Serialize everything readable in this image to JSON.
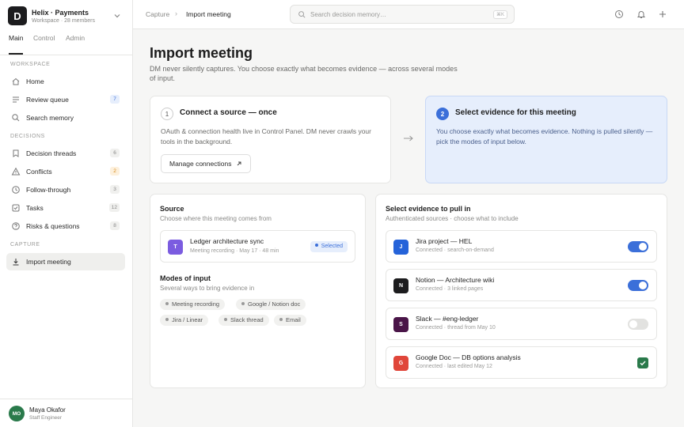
{
  "workspace": {
    "logo": "D",
    "name": "Helix · Payments",
    "subtitle": "Workspace · 28 members"
  },
  "top_tabs": [
    "Main",
    "Control",
    "Admin"
  ],
  "sidebar": {
    "workspace_heading": "WORKSPACE",
    "workspace_items": [
      {
        "label": "Home",
        "icon": "home-icon"
      },
      {
        "label": "Review queue",
        "count": "7",
        "icon": "list-icon"
      },
      {
        "label": "Search memory",
        "icon": "search-icon"
      }
    ],
    "decisions_heading": "DECISIONS",
    "decisions_items": [
      {
        "label": "Decision threads",
        "count": "6",
        "icon": "bookmark-icon"
      },
      {
        "label": "Conflicts",
        "count": "2",
        "icon": "warning-icon"
      },
      {
        "label": "Follow-through",
        "count": "3",
        "icon": "clock-icon"
      },
      {
        "label": "Tasks",
        "count": "12",
        "icon": "checkbox-icon"
      },
      {
        "label": "Risks & questions",
        "count": "8",
        "icon": "question-icon"
      }
    ],
    "capture_heading": "CAPTURE",
    "capture_items": [
      {
        "label": "Import meeting",
        "icon": "download-icon",
        "active": true
      }
    ]
  },
  "user": {
    "initials": "MO",
    "name": "Maya Okafor",
    "role": "Staff Engineer"
  },
  "breadcrumb": {
    "parent": "Capture",
    "separator": "›",
    "current": "Import meeting"
  },
  "search": {
    "placeholder": "Search decision memory…",
    "shortcut": "⌘K"
  },
  "page": {
    "title": "Import meeting",
    "lede": "DM never silently captures. You choose exactly what becomes evidence — across several modes of input."
  },
  "steps": [
    {
      "number": "1",
      "title": "Connect a source — once",
      "body": "OAuth & connection health live in Control Panel. DM never crawls your tools in the background.",
      "button": "Manage connections"
    },
    {
      "number": "2",
      "title": "Select evidence for this meeting",
      "body": "You choose exactly what becomes evidence. Nothing is pulled silently — pick the modes of input below."
    }
  ],
  "source": {
    "title": "Source",
    "subtitle": "Choose where this meeting comes from",
    "meeting": {
      "avatar": "T",
      "title": "Ledger architecture sync",
      "meta": "Meeting recording · May 17 · 48 min",
      "badge": "Selected"
    },
    "modes_title": "Modes of input",
    "modes_subtitle": "Several ways to bring evidence in",
    "modes": [
      "Meeting recording",
      "Google / Notion doc",
      "Jira / Linear",
      "Slack thread",
      "Email"
    ]
  },
  "evidence": {
    "title": "Select evidence to pull in",
    "subtitle": "Authenticated sources · choose what to include",
    "items": [
      {
        "icon": "J",
        "color": "#2563d9",
        "title": "Jira project — HEL",
        "meta": "Connected · search-on-demand",
        "control": "toggle",
        "on": true
      },
      {
        "icon": "N",
        "color": "#1c1c1e",
        "title": "Notion — Architecture wiki",
        "meta": "Connected · 3 linked pages",
        "control": "toggle",
        "on": true
      },
      {
        "icon": "S",
        "color": "#4a1548",
        "title": "Slack — #eng-ledger",
        "meta": "Connected · thread from May 10",
        "control": "toggle",
        "on": false
      },
      {
        "icon": "G",
        "color": "#e0463a",
        "title": "Google Doc — DB options analysis",
        "meta": "Connected · last edited May 12",
        "control": "checkbox",
        "on": true
      }
    ]
  }
}
